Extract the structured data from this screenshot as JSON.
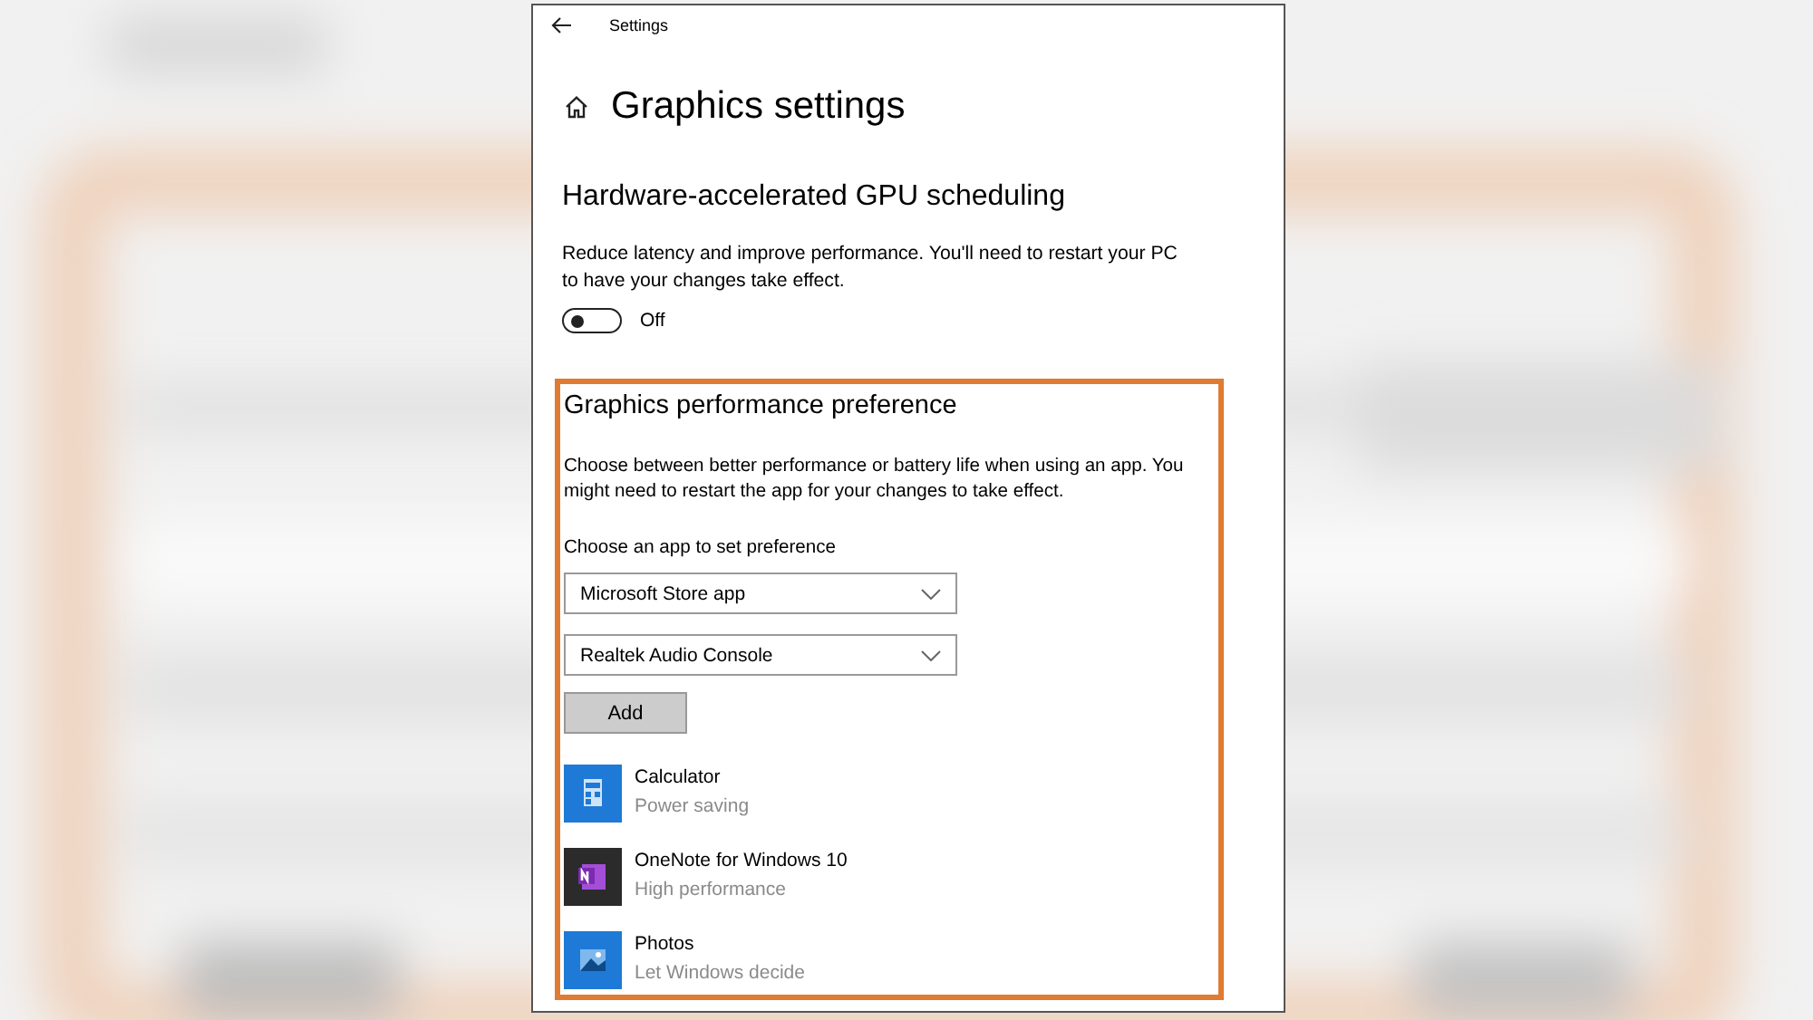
{
  "window": {
    "title": "Settings"
  },
  "page_title": "Graphics settings",
  "gpu_scheduling": {
    "heading": "Hardware-accelerated GPU scheduling",
    "description": "Reduce latency and improve performance. You'll need to restart your PC to have your changes take effect.",
    "toggle": {
      "on": false,
      "label": "Off"
    }
  },
  "performance_preference": {
    "heading": "Graphics performance preference",
    "description": "Choose between better performance or battery life when using an app. You might need to restart the app for your changes to take effect.",
    "select_label": "Choose an app to set preference",
    "dropdowns": [
      {
        "value": "Microsoft Store app"
      },
      {
        "value": "Realtek Audio Console"
      }
    ],
    "add_button": "Add",
    "apps": [
      {
        "kind": "calculator",
        "name": "Calculator",
        "status": "Power saving"
      },
      {
        "kind": "onenote",
        "name": "OneNote for Windows 10",
        "status": "High performance"
      },
      {
        "kind": "photos",
        "name": "Photos",
        "status": "Let Windows decide"
      }
    ]
  }
}
